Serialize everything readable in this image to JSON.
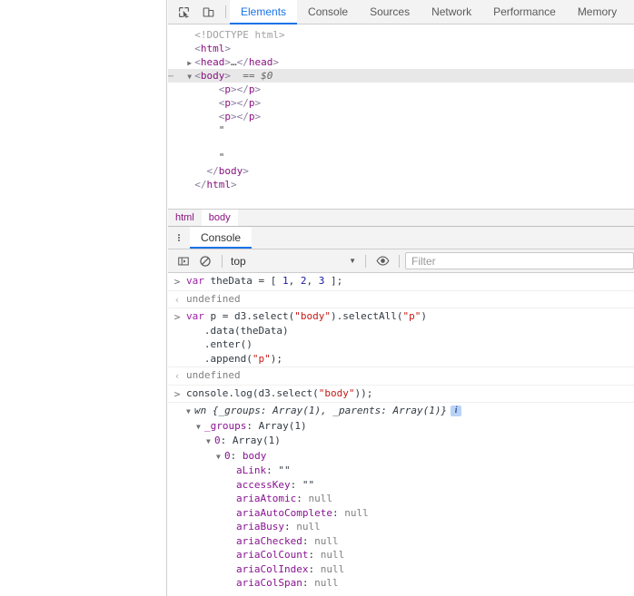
{
  "page": {
    "content": ""
  },
  "toolbar": {
    "inspect_icon": "inspect-cursor-icon",
    "device_icon": "device-toolbar-icon",
    "tabs": [
      {
        "label": "Elements",
        "active": true
      },
      {
        "label": "Console",
        "active": false
      },
      {
        "label": "Sources",
        "active": false
      },
      {
        "label": "Network",
        "active": false
      },
      {
        "label": "Performance",
        "active": false
      },
      {
        "label": "Memory",
        "active": false
      }
    ],
    "active_tab": "Elements",
    "accent_color": "#1a73e8"
  },
  "elements": {
    "rows": [
      {
        "indent": 1,
        "triangle": "",
        "selected": false,
        "parts": [
          {
            "t": "doctype",
            "v": "<!DOCTYPE html>"
          }
        ]
      },
      {
        "indent": 1,
        "triangle": "",
        "selected": false,
        "parts": [
          {
            "t": "punct",
            "v": "<"
          },
          {
            "t": "tag",
            "v": "html"
          },
          {
            "t": "punct",
            "v": ">"
          }
        ]
      },
      {
        "indent": 1,
        "triangle": "▶",
        "selected": false,
        "parts": [
          {
            "t": "punct",
            "v": "<"
          },
          {
            "t": "tag",
            "v": "head"
          },
          {
            "t": "punct",
            "v": ">"
          },
          {
            "t": "text",
            "v": "…"
          },
          {
            "t": "punct",
            "v": "</"
          },
          {
            "t": "tag",
            "v": "head"
          },
          {
            "t": "punct",
            "v": ">"
          }
        ]
      },
      {
        "indent": 1,
        "triangle": "▼",
        "selected": true,
        "ellipsis": "⋯",
        "parts": [
          {
            "t": "punct",
            "v": "<"
          },
          {
            "t": "tag",
            "v": "body"
          },
          {
            "t": "punct",
            "v": ">"
          },
          {
            "t": "eq",
            "v": "  == "
          },
          {
            "t": "ref",
            "v": "$0"
          }
        ]
      },
      {
        "indent": 3,
        "triangle": "",
        "selected": false,
        "parts": [
          {
            "t": "punct",
            "v": "<"
          },
          {
            "t": "tag",
            "v": "p"
          },
          {
            "t": "punct",
            "v": "></"
          },
          {
            "t": "tag",
            "v": "p"
          },
          {
            "t": "punct",
            "v": ">"
          }
        ]
      },
      {
        "indent": 3,
        "triangle": "",
        "selected": false,
        "parts": [
          {
            "t": "punct",
            "v": "<"
          },
          {
            "t": "tag",
            "v": "p"
          },
          {
            "t": "punct",
            "v": "></"
          },
          {
            "t": "tag",
            "v": "p"
          },
          {
            "t": "punct",
            "v": ">"
          }
        ]
      },
      {
        "indent": 3,
        "triangle": "",
        "selected": false,
        "parts": [
          {
            "t": "punct",
            "v": "<"
          },
          {
            "t": "tag",
            "v": "p"
          },
          {
            "t": "punct",
            "v": "></"
          },
          {
            "t": "tag",
            "v": "p"
          },
          {
            "t": "punct",
            "v": ">"
          }
        ]
      },
      {
        "indent": 3,
        "triangle": "",
        "selected": false,
        "parts": [
          {
            "t": "text",
            "v": "\""
          }
        ]
      },
      {
        "indent": 3,
        "triangle": "",
        "selected": false,
        "parts": [
          {
            "t": "text",
            "v": ""
          }
        ]
      },
      {
        "indent": 3,
        "triangle": "",
        "selected": false,
        "parts": [
          {
            "t": "text",
            "v": "\""
          }
        ]
      },
      {
        "indent": 2,
        "triangle": "",
        "selected": false,
        "parts": [
          {
            "t": "punct",
            "v": "</"
          },
          {
            "t": "tag",
            "v": "body"
          },
          {
            "t": "punct",
            "v": ">"
          }
        ]
      },
      {
        "indent": 1,
        "triangle": "",
        "selected": false,
        "parts": [
          {
            "t": "punct",
            "v": "</"
          },
          {
            "t": "tag",
            "v": "html"
          },
          {
            "t": "punct",
            "v": ">"
          }
        ]
      }
    ]
  },
  "breadcrumb": {
    "items": [
      {
        "label": "html",
        "active": false
      },
      {
        "label": "body",
        "active": true
      }
    ]
  },
  "drawer": {
    "kebab_icon": "more-options-icon",
    "tabs": [
      {
        "label": "Console",
        "active": true
      }
    ]
  },
  "console_toolbar": {
    "sidebar_icon": "console-sidebar-toggle-icon",
    "clear_icon": "clear-console-icon",
    "context": "top",
    "context_arrow": "▼",
    "eye_icon": "live-expression-eye-icon",
    "filter_placeholder": "Filter",
    "filter_value": ""
  },
  "console": {
    "messages": [
      {
        "kind": "input",
        "gutter": ">",
        "lines": [
          [
            {
              "t": "kw",
              "v": "var"
            },
            {
              "t": "plain",
              "v": " theData = [ "
            },
            {
              "t": "num",
              "v": "1"
            },
            {
              "t": "plain",
              "v": ", "
            },
            {
              "t": "num",
              "v": "2"
            },
            {
              "t": "plain",
              "v": ", "
            },
            {
              "t": "num",
              "v": "3"
            },
            {
              "t": "plain",
              "v": " ];"
            }
          ]
        ]
      },
      {
        "kind": "output",
        "gutter": "‹",
        "lines": [
          [
            {
              "t": "undef",
              "v": "undefined"
            }
          ]
        ]
      },
      {
        "kind": "input",
        "gutter": ">",
        "lines": [
          [
            {
              "t": "kw",
              "v": "var"
            },
            {
              "t": "plain",
              "v": " p = d3.select("
            },
            {
              "t": "str",
              "v": "\"body\""
            },
            {
              "t": "plain",
              "v": ").selectAll("
            },
            {
              "t": "str",
              "v": "\"p\""
            },
            {
              "t": "plain",
              "v": ")"
            }
          ],
          [
            {
              "t": "plain",
              "v": "   .data(theData)"
            }
          ],
          [
            {
              "t": "plain",
              "v": "   .enter()"
            }
          ],
          [
            {
              "t": "plain",
              "v": "   .append("
            },
            {
              "t": "str",
              "v": "\"p\""
            },
            {
              "t": "plain",
              "v": ");"
            }
          ]
        ]
      },
      {
        "kind": "output",
        "gutter": "‹",
        "lines": [
          [
            {
              "t": "undef",
              "v": "undefined"
            }
          ]
        ]
      },
      {
        "kind": "input",
        "gutter": ">",
        "lines": [
          [
            {
              "t": "plain",
              "v": "console.log(d3.select("
            },
            {
              "t": "str",
              "v": "\"body\""
            },
            {
              "t": "plain",
              "v": "));"
            }
          ]
        ]
      }
    ],
    "object_tree": {
      "header": {
        "triangle": "▼",
        "constructor": "wn",
        "preview": "{_groups: Array(1), _parents: Array(1)}",
        "info_badge": "i"
      },
      "nodes": [
        {
          "indent": 1,
          "triangle": "▼",
          "key": "_groups",
          "sep": ": ",
          "value": "Array(1)",
          "vtype": "plain"
        },
        {
          "indent": 2,
          "triangle": "▼",
          "key": "0",
          "sep": ": ",
          "value": "Array(1)",
          "vtype": "plain"
        },
        {
          "indent": 3,
          "triangle": "▼",
          "key": "0",
          "sep": ": ",
          "value": "body",
          "vtype": "tag"
        }
      ],
      "properties": [
        {
          "key": "aLink",
          "value": "\"\"",
          "vtype": "string"
        },
        {
          "key": "accessKey",
          "value": "\"\"",
          "vtype": "string"
        },
        {
          "key": "ariaAtomic",
          "value": "null",
          "vtype": "null"
        },
        {
          "key": "ariaAutoComplete",
          "value": "null",
          "vtype": "null"
        },
        {
          "key": "ariaBusy",
          "value": "null",
          "vtype": "null"
        },
        {
          "key": "ariaChecked",
          "value": "null",
          "vtype": "null"
        },
        {
          "key": "ariaColCount",
          "value": "null",
          "vtype": "null"
        },
        {
          "key": "ariaColIndex",
          "value": "null",
          "vtype": "null"
        },
        {
          "key": "ariaColSpan",
          "value": "null",
          "vtype": "null"
        }
      ]
    }
  }
}
